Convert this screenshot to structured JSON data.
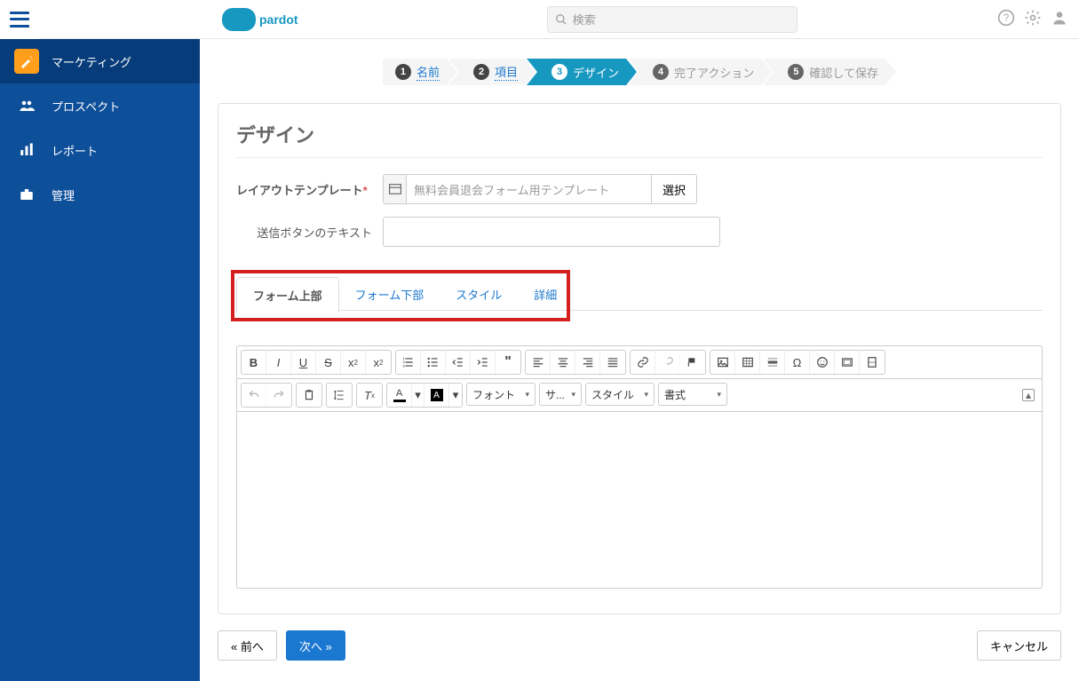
{
  "header": {
    "logo_text": "pardot",
    "search_placeholder": "検索"
  },
  "sidebar": {
    "items": [
      {
        "label": "マーケティング"
      },
      {
        "label": "プロスペクト"
      },
      {
        "label": "レポート"
      },
      {
        "label": "管理"
      }
    ]
  },
  "steps": [
    {
      "num": "1",
      "label": "名前"
    },
    {
      "num": "2",
      "label": "項目"
    },
    {
      "num": "3",
      "label": "デザイン"
    },
    {
      "num": "4",
      "label": "完了アクション"
    },
    {
      "num": "5",
      "label": "確認して保存"
    }
  ],
  "design": {
    "title": "デザイン",
    "layout_label": "レイアウトテンプレート",
    "layout_value": "無料会員退会フォーム用テンプレート",
    "select_btn": "選択",
    "submit_label": "送信ボタンのテキスト",
    "submit_value": ""
  },
  "tabs": [
    {
      "label": "フォーム上部"
    },
    {
      "label": "フォーム下部"
    },
    {
      "label": "スタイル"
    },
    {
      "label": "詳細"
    }
  ],
  "toolbar": {
    "font_label": "フォント",
    "size_label": "サ...",
    "style_label": "スタイル",
    "format_label": "書式"
  },
  "footer": {
    "prev": "« 前へ",
    "next": "次へ »",
    "cancel": "キャンセル"
  }
}
